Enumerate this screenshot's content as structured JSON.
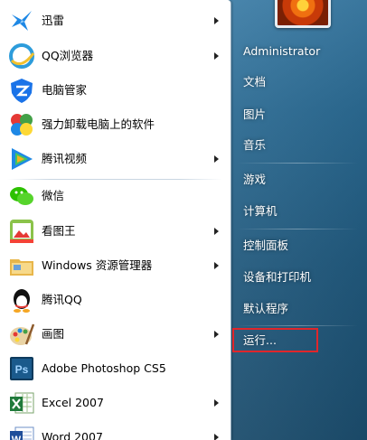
{
  "left_programs": [
    {
      "label": "迅雷",
      "icon": "xunlei-icon",
      "has_submenu": true
    },
    {
      "label": "QQ浏览器",
      "icon": "qq-browser-icon",
      "has_submenu": true
    },
    {
      "label": "电脑管家",
      "icon": "pc-manager-icon",
      "has_submenu": false
    },
    {
      "label": "强力卸载电脑上的软件",
      "icon": "uninstaller-icon",
      "has_submenu": false
    },
    {
      "label": "腾讯视频",
      "icon": "tencent-video-icon",
      "has_submenu": true
    },
    {
      "label": "微信",
      "icon": "wechat-icon",
      "has_submenu": false
    },
    {
      "label": "看图王",
      "icon": "image-viewer-icon",
      "has_submenu": true
    },
    {
      "label": "Windows 资源管理器",
      "icon": "explorer-icon",
      "has_submenu": true
    },
    {
      "label": "腾讯QQ",
      "icon": "qq-icon",
      "has_submenu": false
    },
    {
      "label": "画图",
      "icon": "paint-icon",
      "has_submenu": true
    },
    {
      "label": "Adobe Photoshop CS5",
      "icon": "photoshop-icon",
      "has_submenu": false
    },
    {
      "label": "Excel 2007",
      "icon": "excel-icon",
      "has_submenu": true
    },
    {
      "label": "Word 2007",
      "icon": "word-icon",
      "has_submenu": true
    }
  ],
  "right_items": [
    {
      "label": "Administrator"
    },
    {
      "label": "文档"
    },
    {
      "label": "图片"
    },
    {
      "label": "音乐"
    },
    {
      "label": "游戏"
    },
    {
      "label": "计算机"
    },
    {
      "label": "控制面板"
    },
    {
      "label": "设备和打印机"
    },
    {
      "label": "默认程序"
    },
    {
      "label": "运行..."
    }
  ],
  "colors": {
    "highlight_box": "#e0262b",
    "panel_blue": "#2b6a92"
  }
}
